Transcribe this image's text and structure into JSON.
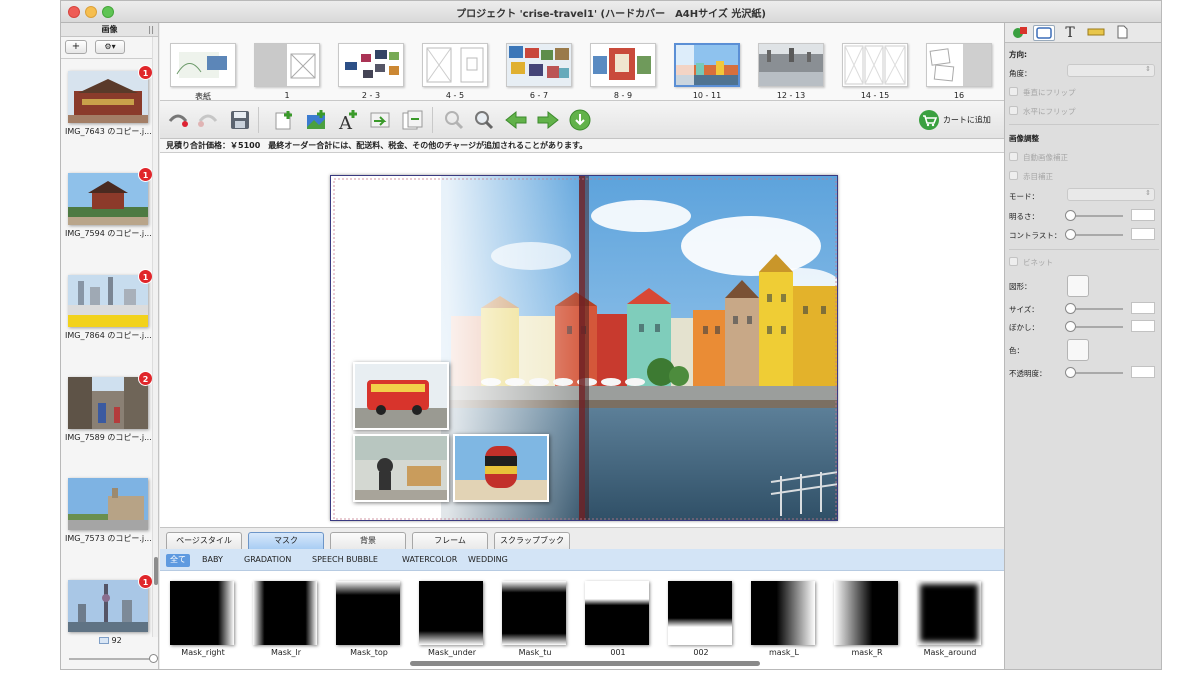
{
  "window": {
    "title": "プロジェクト 'crise-travel1' (ハードカバー　A4Hサイズ 光沢紙)",
    "traffic_lights": {
      "close": "#ee5c56",
      "minimize": "#f6be4f",
      "zoom": "#5fc454"
    }
  },
  "left_panel": {
    "header": "画像",
    "add_label": "+",
    "gear_label": "⚙▾",
    "photos": [
      {
        "caption": "IMG_7643 のコピー.j...",
        "badge": "1"
      },
      {
        "caption": "IMG_7594 のコピー.j...",
        "badge": "1"
      },
      {
        "caption": "IMG_7864 のコピー.j...",
        "badge": "1"
      },
      {
        "caption": "IMG_7589 のコピー.j...",
        "badge": "2"
      },
      {
        "caption": "IMG_7573 のコピー.j...",
        "badge": ""
      },
      {
        "caption": "",
        "badge": "1"
      }
    ],
    "photo_count": "92"
  },
  "page_strip": {
    "pages": [
      {
        "label": "表紙"
      },
      {
        "label": "1"
      },
      {
        "label": "2 - 3"
      },
      {
        "label": "4 - 5"
      },
      {
        "label": "6 - 7"
      },
      {
        "label": "8 - 9"
      },
      {
        "label": "10 - 11",
        "selected": true
      },
      {
        "label": "12 - 13"
      },
      {
        "label": "14 - 15"
      },
      {
        "label": "16"
      }
    ]
  },
  "toolbar": {
    "cart_label": "カートに追加",
    "icons": [
      "undo-icon",
      "redo-icon",
      "save-icon",
      "add-page-icon",
      "add-photo-icon",
      "add-text-icon",
      "import-icon",
      "export-icon",
      "zoom-out-icon",
      "zoom-in-icon",
      "arrow-left-icon",
      "arrow-right-icon",
      "arrow-down-icon"
    ]
  },
  "notice": "見積り合計価格：￥5100　最終オーダー合計には、配送料、税金、その他のチャージが追加されることがあります。",
  "bottom_tabs": {
    "tabs": [
      "ページスタイル",
      "マスク",
      "背景",
      "フレーム",
      "スクラップブック"
    ],
    "active": 1
  },
  "filters": {
    "items": [
      "全て",
      "BABY",
      "GRADATION",
      "SPEECH BUBBLE",
      "WATERCOLOR",
      "WEDDING"
    ],
    "active": 0
  },
  "masks": {
    "items": [
      "Mask_right",
      "Mask_lr",
      "Mask_top",
      "Mask_under",
      "Mask_tu",
      "001",
      "002",
      "mask_L",
      "mask_R",
      "Mask_around"
    ]
  },
  "inspector": {
    "direction_heading": "方向:",
    "angle_label": "角度：",
    "flip_vertical": "垂直にフリップ",
    "flip_horizontal": "水平にフリップ",
    "image_adjust_heading": "画像調整",
    "auto_correct": "自動画像補正",
    "red_eye": "赤目補正",
    "mode_label": "モード：",
    "brightness_label": "明るさ：",
    "contrast_label": "コントラスト：",
    "vignette_label": "ビネット",
    "shape_label": "図形：",
    "size_label": "サイズ：",
    "blur_label": "ぼかし：",
    "color_label": "色：",
    "opacity_label": "不透明度："
  }
}
